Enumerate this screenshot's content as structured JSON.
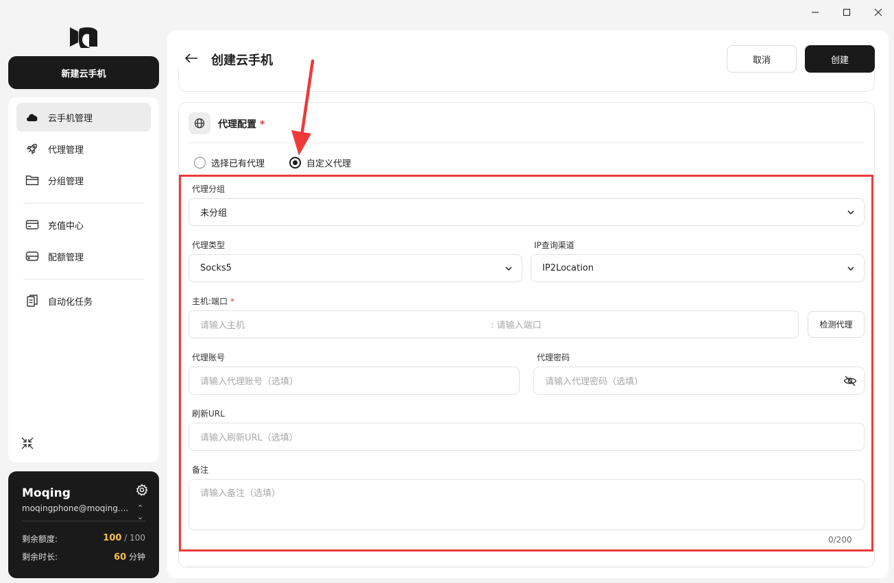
{
  "window_controls": {
    "minimize": "—",
    "maximize": "☐",
    "close": "✕"
  },
  "sidebar": {
    "new_button": "新建云手机",
    "items": [
      {
        "label": "云手机管理",
        "icon": "cloud-icon",
        "active": true
      },
      {
        "label": "代理管理",
        "icon": "rocket-icon",
        "active": false
      },
      {
        "label": "分组管理",
        "icon": "folder-icon",
        "active": false
      },
      {
        "label": "充值中心",
        "icon": "credit-card-icon",
        "active": false
      },
      {
        "label": "配额管理",
        "icon": "database-icon",
        "active": false
      },
      {
        "label": "自动化任务",
        "icon": "clipboard-icon",
        "active": false
      }
    ]
  },
  "user": {
    "name": "Moqing",
    "email": "moqingphone@moqing....",
    "quota_label": "剩余额度:",
    "quota_used": "100",
    "quota_sep": " / ",
    "quota_total": "100",
    "time_label": "剩余时长:",
    "time_value": "60",
    "time_unit": " 分钟"
  },
  "header": {
    "title": "创建云手机",
    "cancel": "取消",
    "create": "创建"
  },
  "proxy_section": {
    "title": "代理配置",
    "required_mark": "*",
    "radio_existing": "选择已有代理",
    "radio_custom": "自定义代理",
    "selected": "custom",
    "group_label": "代理分组",
    "group_value": "未分组",
    "type_label": "代理类型",
    "type_value": "Socks5",
    "ipquery_label": "IP查询渠道",
    "ipquery_value": "IP2Location",
    "host_label": "主机:端口",
    "host_placeholder": "请输入主机",
    "port_placeholder": ":  请输入端口",
    "detect_button": "检测代理",
    "account_label": "代理账号",
    "account_placeholder": "请输入代理账号（选填）",
    "password_label": "代理密码",
    "password_placeholder": "请输入代理密码（选填）",
    "refresh_label": "刷新URL",
    "refresh_placeholder": "请输入刷新URL（选填）",
    "note_label": "备注",
    "note_placeholder": "请输入备注（选填）",
    "note_counter": "0/200"
  },
  "colors": {
    "accent": "#1a1a1a",
    "highlight": "#ee3a3a",
    "quota": "#f5c04a"
  }
}
